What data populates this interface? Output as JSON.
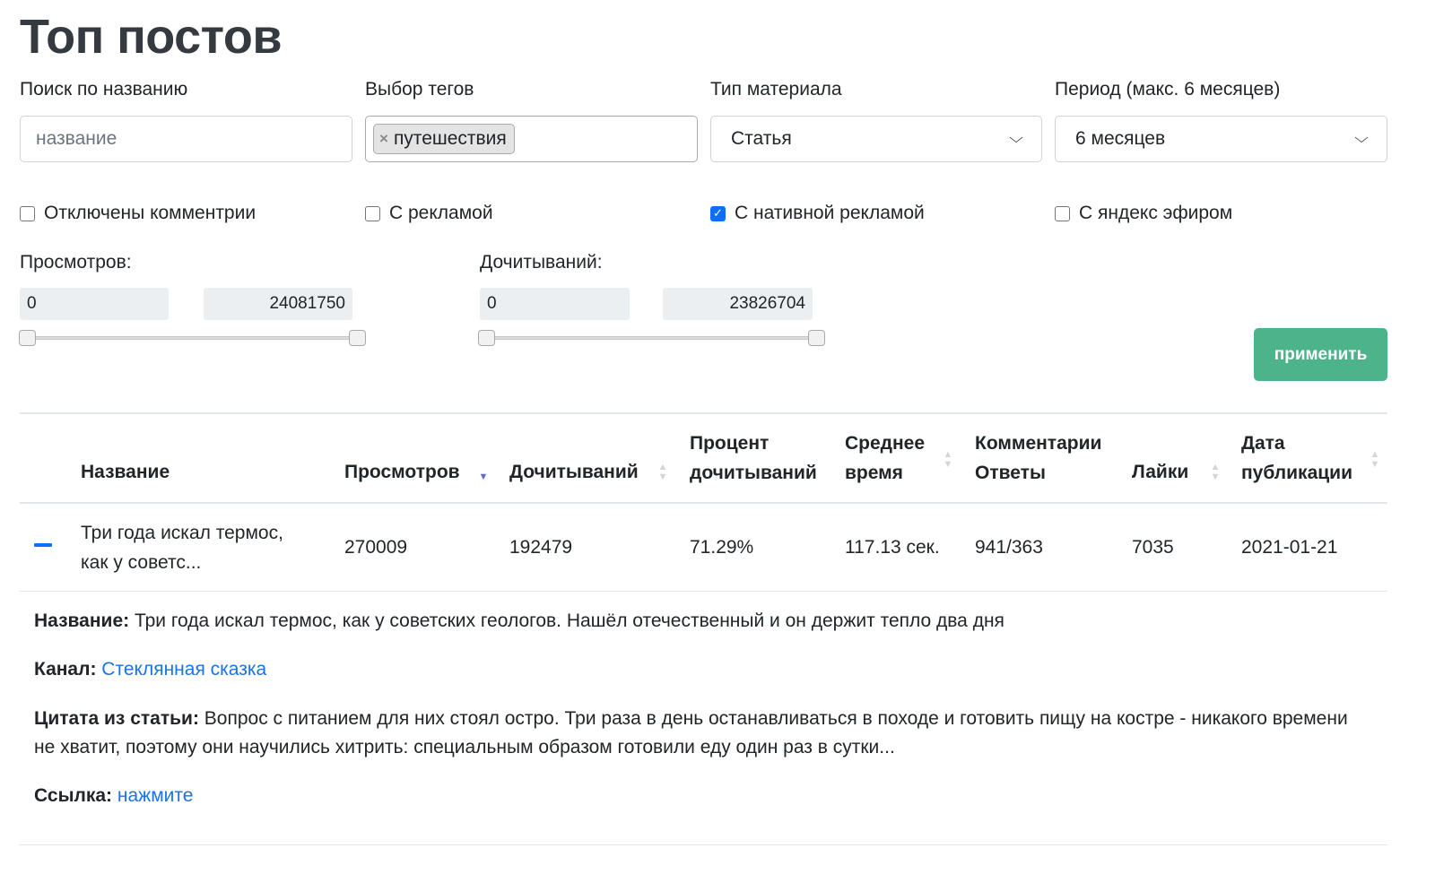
{
  "page": {
    "title": "Топ постов"
  },
  "filters": {
    "search": {
      "label": "Поиск по названию",
      "placeholder": "название",
      "value": ""
    },
    "tags": {
      "label": "Выбор тегов",
      "selected": [
        "путешествия"
      ],
      "remove_glyph": "×"
    },
    "material_type": {
      "label": "Тип материала",
      "value": "Статья"
    },
    "period": {
      "label": "Период (макс. 6 месяцев)",
      "value": "6 месяцев"
    },
    "checkboxes": [
      {
        "label": "Отключены комментрии",
        "checked": false
      },
      {
        "label": "С рекламой",
        "checked": false
      },
      {
        "label": "С нативной рекламой",
        "checked": true
      },
      {
        "label": "С яндекс эфиром",
        "checked": false
      }
    ],
    "views_range": {
      "label": "Просмотров:",
      "min": "0",
      "max": "24081750"
    },
    "reads_range": {
      "label": "Дочитываний:",
      "min": "0",
      "max": "23826704"
    },
    "apply_label": "применить"
  },
  "table": {
    "headers": {
      "name": "Название",
      "views": "Просмотров",
      "reads": "Дочитываний",
      "read_percent_1": "Процент",
      "read_percent_2": "дочитываний",
      "avg_time_1": "Среднее",
      "avg_time_2": "время",
      "comments_1": "Комментарии",
      "comments_2": "Ответы",
      "likes": "Лайки",
      "date_1": "Дата",
      "date_2": "публикации"
    },
    "sort": {
      "active_column": "views",
      "direction": "desc"
    },
    "rows": [
      {
        "name_1": "Три года искал термос,",
        "name_2": "как у советс...",
        "views": "270009",
        "reads": "192479",
        "read_percent": "71.29%",
        "avg_time": "117.13 сек.",
        "comments": "941/363",
        "likes": "7035",
        "date": "2021-01-21",
        "expanded": true
      }
    ]
  },
  "details": {
    "name_label": "Название:",
    "name_value": "Три года искал термос, как у советских геологов. Нашёл отечественный и он держит тепло два дня",
    "channel_label": "Канал:",
    "channel_value": "Стеклянная сказка",
    "quote_label": "Цитата из статьи:",
    "quote_value": "Вопрос с питанием для них стоял остро. Три раза в день останавливаться в походе и готовить пищу на костре - никакого времени не хватит, поэтому они научились хитрить: специальным образом готовили еду один раз в сутки...",
    "link_label": "Ссылка:",
    "link_value": "нажмите"
  },
  "colors": {
    "accent_button": "#4cb38b",
    "link": "#1a73e8",
    "checkbox": "#0d6efd",
    "sort_active": "#5f6bd2"
  },
  "icons": {
    "select_chevron": "chevron-down-icon",
    "sort": "sort-arrows-icon",
    "collapse": "minus-icon"
  }
}
